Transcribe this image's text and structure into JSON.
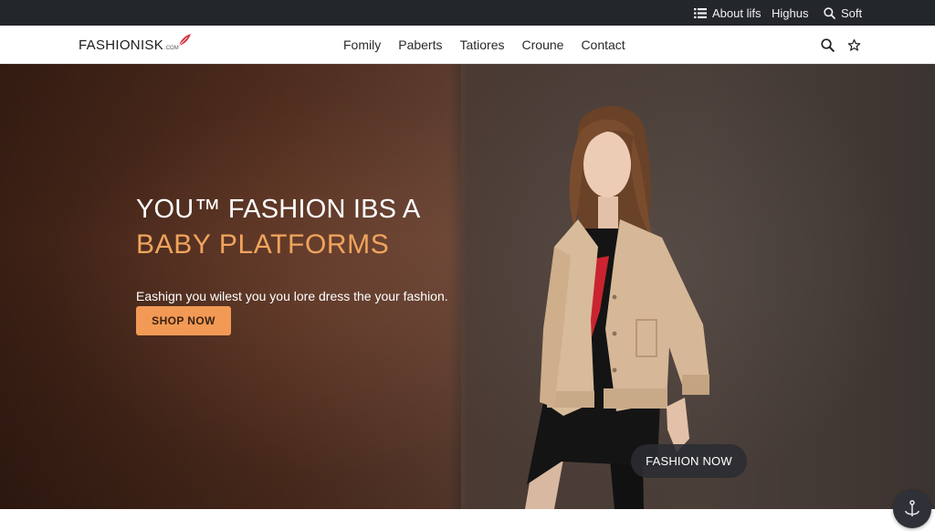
{
  "topbar": {
    "about_label": "About lifs",
    "highus_label": "Highus",
    "soft_label": "Soft"
  },
  "nav": {
    "logo_text": "FASHIONISK",
    "logo_suffix": ".COM",
    "links": [
      "Fomily",
      "Paberts",
      "Tatiores",
      "Croune",
      "Contact"
    ]
  },
  "hero": {
    "headline": "YOU™ FASHION IBS A",
    "headline_accent": "BABY PLATFORMS",
    "subtext": "Eashign you wilest you you lore dress the your fashion.",
    "cta_label": "SHOP NOW",
    "secondary_cta_label": "FASHION NOW"
  },
  "colors": {
    "topbar_bg": "#23262b",
    "accent_orange": "#f29a55",
    "headline_accent": "#f0a45c",
    "logo_leaf": "#d2353f"
  },
  "icons": [
    "list-icon",
    "search-icon",
    "star-icon",
    "leaf-icon",
    "anchor-icon"
  ]
}
